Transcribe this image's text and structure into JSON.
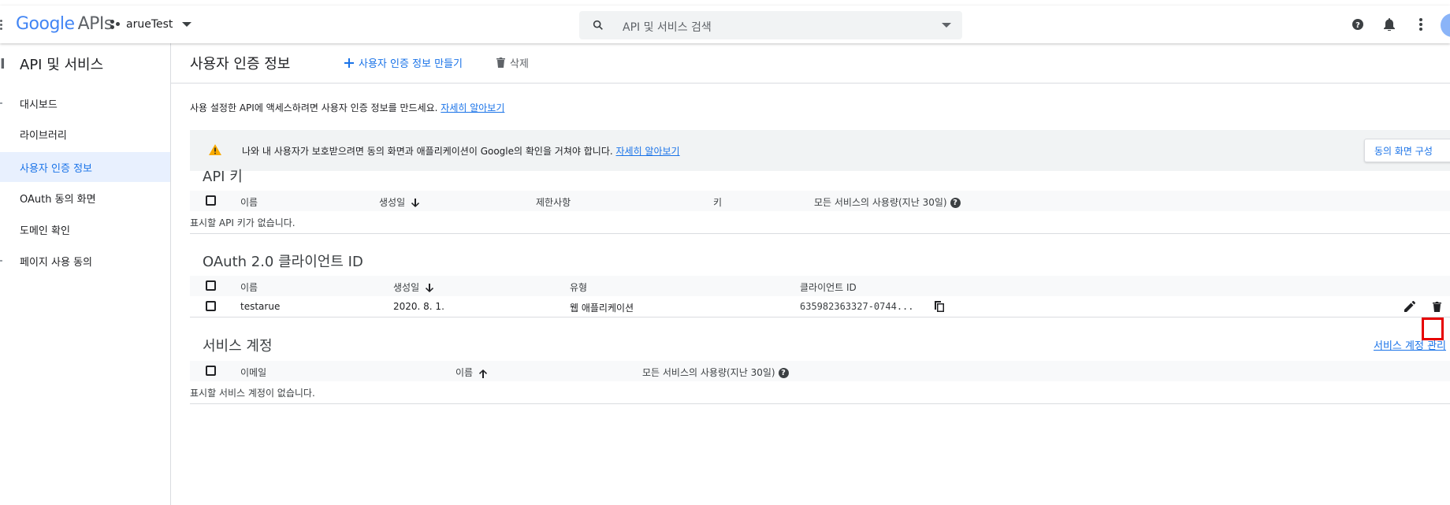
{
  "topbar": {
    "logo_google": "Google",
    "logo_apis": "APIs",
    "project_name": "arueTest",
    "search_placeholder": "API 및 서비스 검색"
  },
  "sidebar": {
    "title": "API 및 서비스",
    "items": [
      {
        "label": "대시보드"
      },
      {
        "label": "라이브러리"
      },
      {
        "label": "사용자 인증 정보",
        "active": true
      },
      {
        "label": "OAuth 동의 화면"
      },
      {
        "label": "도메인 확인"
      },
      {
        "label": "페이지 사용 동의"
      }
    ]
  },
  "page": {
    "title": "사용자 인증 정보",
    "create_label": "사용자 인증 정보 만들기",
    "delete_label": "삭제",
    "intro_text": "사용 설정한 API에 액세스하려면 사용자 인증 정보를 만드세요. ",
    "intro_link": "자세히 알아보기",
    "banner_text": "나와 내 사용자가 보호받으려면 동의 화면과 애플리케이션이 Google의 확인을 거쳐야 합니다. ",
    "banner_link": "자세히 알아보기",
    "consent_button": "동의 화면 구성"
  },
  "api_keys": {
    "title": "API 키",
    "columns": [
      "이름",
      "생성일",
      "제한사항",
      "키",
      "모든 서비스의 사용량(지난 30일)"
    ],
    "empty": "표시할 API 키가 없습니다."
  },
  "oauth": {
    "title": "OAuth 2.0 클라이언트 ID",
    "columns": [
      "이름",
      "생성일",
      "유형",
      "클라이언트 ID"
    ],
    "rows": [
      {
        "name": "testarue",
        "created": "2020. 8. 1.",
        "type": "웹 애플리케이션",
        "client_id": "635982363327-0744..."
      }
    ]
  },
  "service_accounts": {
    "title": "서비스 계정",
    "manage_link": "서비스 계정 관리",
    "columns": [
      "이메일",
      "이름",
      "모든 서비스의 사용량(지난 30일)"
    ],
    "empty": "표시할 서비스 계정이 없습니다."
  },
  "colors": {
    "accent": "#1a73e8",
    "highlight": "#e60000",
    "warning": "#f9ab00"
  }
}
